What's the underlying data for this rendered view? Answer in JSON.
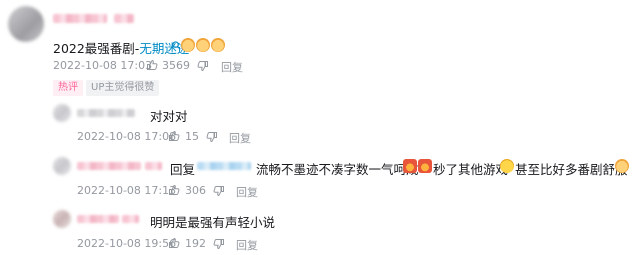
{
  "main_comment": {
    "text": "2022最强番剧-",
    "link_text": "无期迷途",
    "date": "2022-10-08 17:03",
    "likes": "3569",
    "reply_label": "回复",
    "tags": [
      "热评",
      "UP主觉得很赞"
    ]
  },
  "replies": [
    {
      "text": "对对对",
      "date": "2022-10-08 17:08",
      "likes": "15",
      "reply_label": "回复"
    },
    {
      "prefix": "回复",
      "text_a": "流畅不墨迹不凑字数一气呵成",
      "text_b": "秒了其他游戏",
      "text_c": "甚至比好多番剧舒服",
      "date": "2022-10-08 17:13",
      "likes": "306",
      "reply_label": "回复"
    },
    {
      "text": "明明是最强有声轻小说",
      "date": "2022-10-08 19:56",
      "likes": "192",
      "reply_label": "回复"
    }
  ],
  "icons": {
    "like": "thumbs-up-icon",
    "dislike": "thumbs-down-icon",
    "search": "search-icon",
    "emoji_dog": "dog-face-emoji-icon",
    "emoji_fire": "angry-fire-emoji-icon",
    "emoji_sweat": "sweat-smile-emoji-icon"
  },
  "colors": {
    "link": "#008ac5",
    "hot_tag": "#ff6699",
    "meta_grey": "#9499a0"
  }
}
